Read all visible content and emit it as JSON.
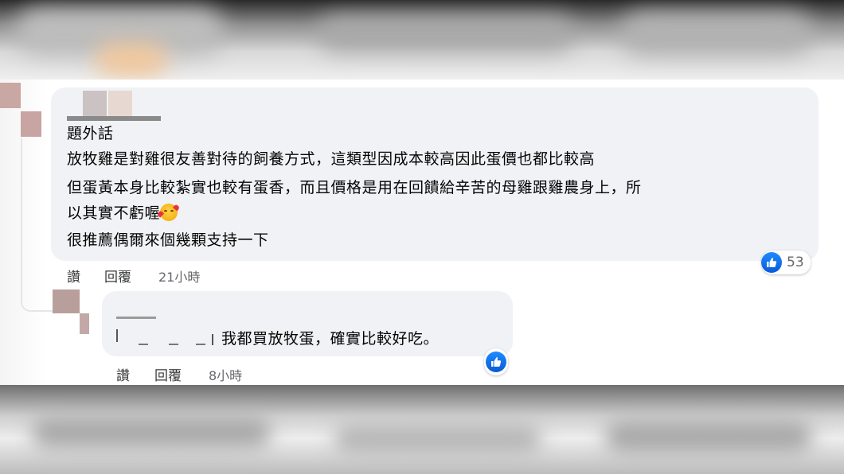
{
  "comment": {
    "title": "題外話",
    "lines": [
      "放牧雞是對雞很友善對待的飼養方式，這類型因成本較高因此蛋價也都比較高",
      "但蛋黃本身比較紮實也較有蛋香，而且價格是用在回饋給辛苦的母雞跟雞農身上，所",
      "以其實不虧喔",
      "很推薦偶爾來個幾顆支持一下"
    ],
    "emoji": "smiling-face-with-hearts-emoji",
    "like_count": "53",
    "actions": {
      "like": "讚",
      "reply": "回覆",
      "time": "21小時"
    }
  },
  "reply": {
    "text": "我都買放牧蛋，確實比較好吃。",
    "actions": {
      "like": "讚",
      "reply": "回覆",
      "time": "8小時"
    }
  },
  "colors": {
    "bubble": "#f0f2f5",
    "like_blue": "#1877f2",
    "meta_text": "#65676b"
  }
}
